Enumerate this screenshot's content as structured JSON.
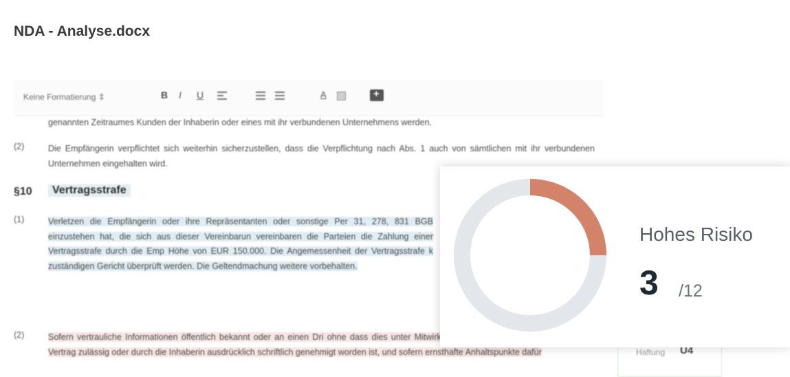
{
  "document": {
    "title": "NDA - Analyse.docx"
  },
  "toolbar": {
    "format_select": "Keine Formatierung ⇕",
    "bold": "B",
    "italic": "I",
    "underline": "U",
    "font_color": "A"
  },
  "content": {
    "line_prev": "genannten Zeitraumes Kunden der Inhaberin oder eines mit ihr verbundenen Unternehmens werden.",
    "para2_num": "(2)",
    "para2_text": "Die Empfängerin verpflichtet sich weiterhin sicherzustellen, dass die Verpflichtung nach Abs. 1 auch von sämtlichen mit ihr verbundenen Unternehmen eingehalten wird.",
    "section_num": "§10",
    "section_title": "Vertragsstrafe",
    "p1_num": "(1)",
    "p1_text": "Verletzen die Empfängerin oder ihre Repräsentanten oder sonstige Per 31, 278, 831 BGB einzustehen hat, die sich aus dieser Vereinbarun vereinbaren die Parteien die Zahlung einer Vertragsstrafe durch die Emp Höhe von EUR 150.000. Die Angemessenheit der Vertragsstrafe k zuständigen Gericht überprüft werden. Die Geltendmachung weitere vorbehalten.",
    "p2_num": "(2)",
    "p2_text": "Sofern vertrauliche Informationen öffentlich bekannt oder an einen Dri ohne dass dies unter Mitwirkung der Inhaberin erfolgt, nach diesem Vertrag zulässig oder durch die Inhaberin ausdrücklich schriftlich genehmigt worden ist, und sofern ernsthafte Anhaltspunkte dafür"
  },
  "side_box": {
    "label": "Haftung",
    "value": "U4"
  },
  "risk": {
    "label": "Hohes Risiko",
    "count": "3",
    "total": "/12",
    "fraction": 0.25,
    "ring_color": "#d4836b",
    "track_color": "#e3e6ea"
  }
}
